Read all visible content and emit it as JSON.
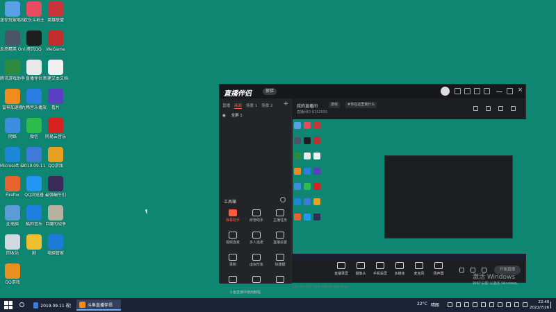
{
  "desktop": {
    "icons": [
      {
        "label": "迷你玩家电视",
        "color": "#5aa0e6"
      },
      {
        "label": "欢乐斗地主",
        "color": "#e84a5f"
      },
      {
        "label": "英雄联盟",
        "color": "#c8343a"
      },
      {
        "label": "反恐精英 Online",
        "color": "#4a5568"
      },
      {
        "label": "腾讯QQ",
        "color": "#1e1e1e"
      },
      {
        "label": "WeGame",
        "color": "#c22d2d"
      },
      {
        "label": "腾讯游戏助手",
        "color": "#2d8a3e"
      },
      {
        "label": "直播伴侣",
        "color": "#e8e8e8"
      },
      {
        "label": "新建文本文档",
        "color": "#f0f0f0"
      },
      {
        "label": "雷神加速器",
        "color": "#f08c1e"
      },
      {
        "label": "九畅音乐播放",
        "color": "#2a7de1"
      },
      {
        "label": "看片",
        "color": "#5a3fc0"
      },
      {
        "label": "网络",
        "color": "#3b8ee0"
      },
      {
        "label": "微信",
        "color": "#2dbb4d"
      },
      {
        "label": "网易云音乐",
        "color": "#d82020"
      },
      {
        "label": "Microsoft Edge",
        "color": "#1e88d8"
      },
      {
        "label": "2019.09.11 ...",
        "color": "#3e7bd6"
      },
      {
        "label": "QQ游戏",
        "color": "#e8a020"
      },
      {
        "label": "Firefox",
        "color": "#e8642c"
      },
      {
        "label": "QQ浏览器",
        "color": "#2196f3"
      },
      {
        "label": "最强蜗牛们",
        "color": "#3a2a5a"
      },
      {
        "label": "此电脑",
        "color": "#5a9bd8"
      },
      {
        "label": "酷狗音乐",
        "color": "#1f7fe0"
      },
      {
        "label": "巨魔的战争",
        "color": "#b8b0a0"
      },
      {
        "label": "回收站",
        "color": "#d0d8e0"
      },
      {
        "label": "剧",
        "color": "#f0c030"
      },
      {
        "label": "电脑管家",
        "color": "#1e7ad8"
      },
      {
        "label": "QQ游戏",
        "color": "#e89020"
      }
    ]
  },
  "app": {
    "logo": "直播伴侣",
    "badge": "体验",
    "scene_tabs": [
      "直播",
      "画面",
      "场景 1",
      "场景 2"
    ],
    "active_scene_tab": 1,
    "add_label": "+",
    "source_item": "全屏 1",
    "tools_title": "工具箱",
    "tools": [
      {
        "label": "弹幕助手",
        "accent": true
      },
      {
        "label": "房管助手",
        "accent": false
      },
      {
        "label": "主播任务",
        "accent": false
      },
      {
        "label": "视频连麦",
        "accent": false
      },
      {
        "label": "多人连麦",
        "accent": false
      },
      {
        "label": "直播设置",
        "accent": false
      },
      {
        "label": "录制",
        "accent": false
      },
      {
        "label": "虚拟形象",
        "accent": false
      },
      {
        "label": "快捷键",
        "accent": false
      },
      {
        "label": "",
        "accent": false
      },
      {
        "label": "",
        "accent": false
      },
      {
        "label": "",
        "accent": false
      }
    ],
    "bottom_left": "斗鱼直播中使用教程",
    "room_title": "我的直播间",
    "tag_1": "游戏",
    "tag_2": "#你在这里做什么",
    "sub_row": "直播间ID  6152555",
    "controls": [
      {
        "label": "直播录屏"
      },
      {
        "label": "摄像头"
      },
      {
        "label": "手机投屏"
      },
      {
        "label": "多媒体"
      },
      {
        "label": "麦克风"
      },
      {
        "label": "扬声器"
      }
    ],
    "start_label": "开始直播",
    "stats": "CPU:0%   内存:32%   帧率:60   码率:0kb/s"
  },
  "watermark": {
    "line1": "激活 Windows",
    "line2": "转到\"设置\"以激活 Windows。"
  },
  "taskbar": {
    "tasks": [
      {
        "label": "2019.09.11 视频...",
        "active": false,
        "color": "#3e7bd6"
      },
      {
        "label": "斗鱼直播伴侣",
        "active": true,
        "color": "#f08c1e"
      }
    ],
    "weather": "22°C",
    "weather_desc": "晴朗",
    "time": "22:40",
    "date": "2022/7/26"
  }
}
